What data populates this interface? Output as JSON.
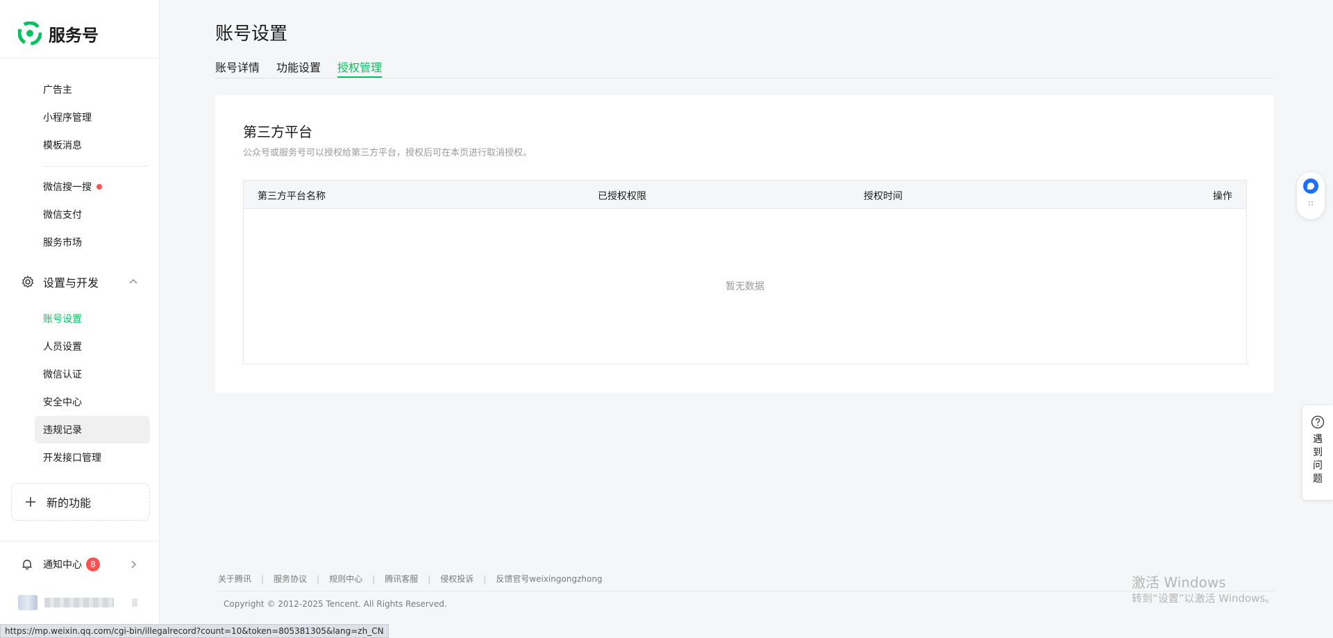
{
  "brand": {
    "name": "服务号",
    "logo_icon": "wechat-service-logo-icon",
    "accent": "#07c160"
  },
  "sidebar": {
    "items_top": [
      {
        "label": "广告主"
      },
      {
        "label": "小程序管理"
      },
      {
        "label": "模板消息"
      }
    ],
    "items_mid": [
      {
        "label": "微信搜一搜",
        "dot": true
      },
      {
        "label": "微信支付"
      },
      {
        "label": "服务市场"
      }
    ],
    "section": {
      "label": "设置与开发",
      "icon": "gear-icon"
    },
    "items_section": [
      {
        "label": "账号设置",
        "active": true
      },
      {
        "label": "人员设置"
      },
      {
        "label": "微信认证"
      },
      {
        "label": "安全中心"
      },
      {
        "label": "违规记录",
        "hover": true
      },
      {
        "label": "开发接口管理"
      }
    ],
    "new_feature": {
      "label": "新的功能"
    },
    "notify": {
      "label": "通知中心",
      "badge": "8"
    }
  },
  "page": {
    "title": "账号设置",
    "tabs": [
      {
        "label": "账号详情"
      },
      {
        "label": "功能设置"
      },
      {
        "label": "授权管理",
        "active": true
      }
    ]
  },
  "card": {
    "title": "第三方平台",
    "desc": "公众号或服务号可以授权给第三方平台，授权后可在本页进行取消授权。",
    "table": {
      "columns": [
        "第三方平台名称",
        "已授权权限",
        "授权时间",
        "操作"
      ],
      "empty": "暂无数据"
    }
  },
  "footer": {
    "links": [
      "关于腾讯",
      "服务协议",
      "规则中心",
      "腾讯客服",
      "侵权投诉",
      "反馈官号weixingongzhong"
    ],
    "copyright": "Copyright © 2012-2025 Tencent. All Rights Reserved."
  },
  "watermark": {
    "line1": "激活 Windows",
    "line2": "转到“设置”以激活 Windows。"
  },
  "statusbar": {
    "url": "https://mp.weixin.qq.com/cgi-bin/illegalrecord?count=10&token=805381305&lang=zh_CN"
  },
  "help": {
    "text": "遇到问题",
    "icon": "question-circle-icon"
  },
  "float": {
    "chat_icon": "chat-bubble-icon",
    "drag_icon": "drag-handle-icon"
  }
}
